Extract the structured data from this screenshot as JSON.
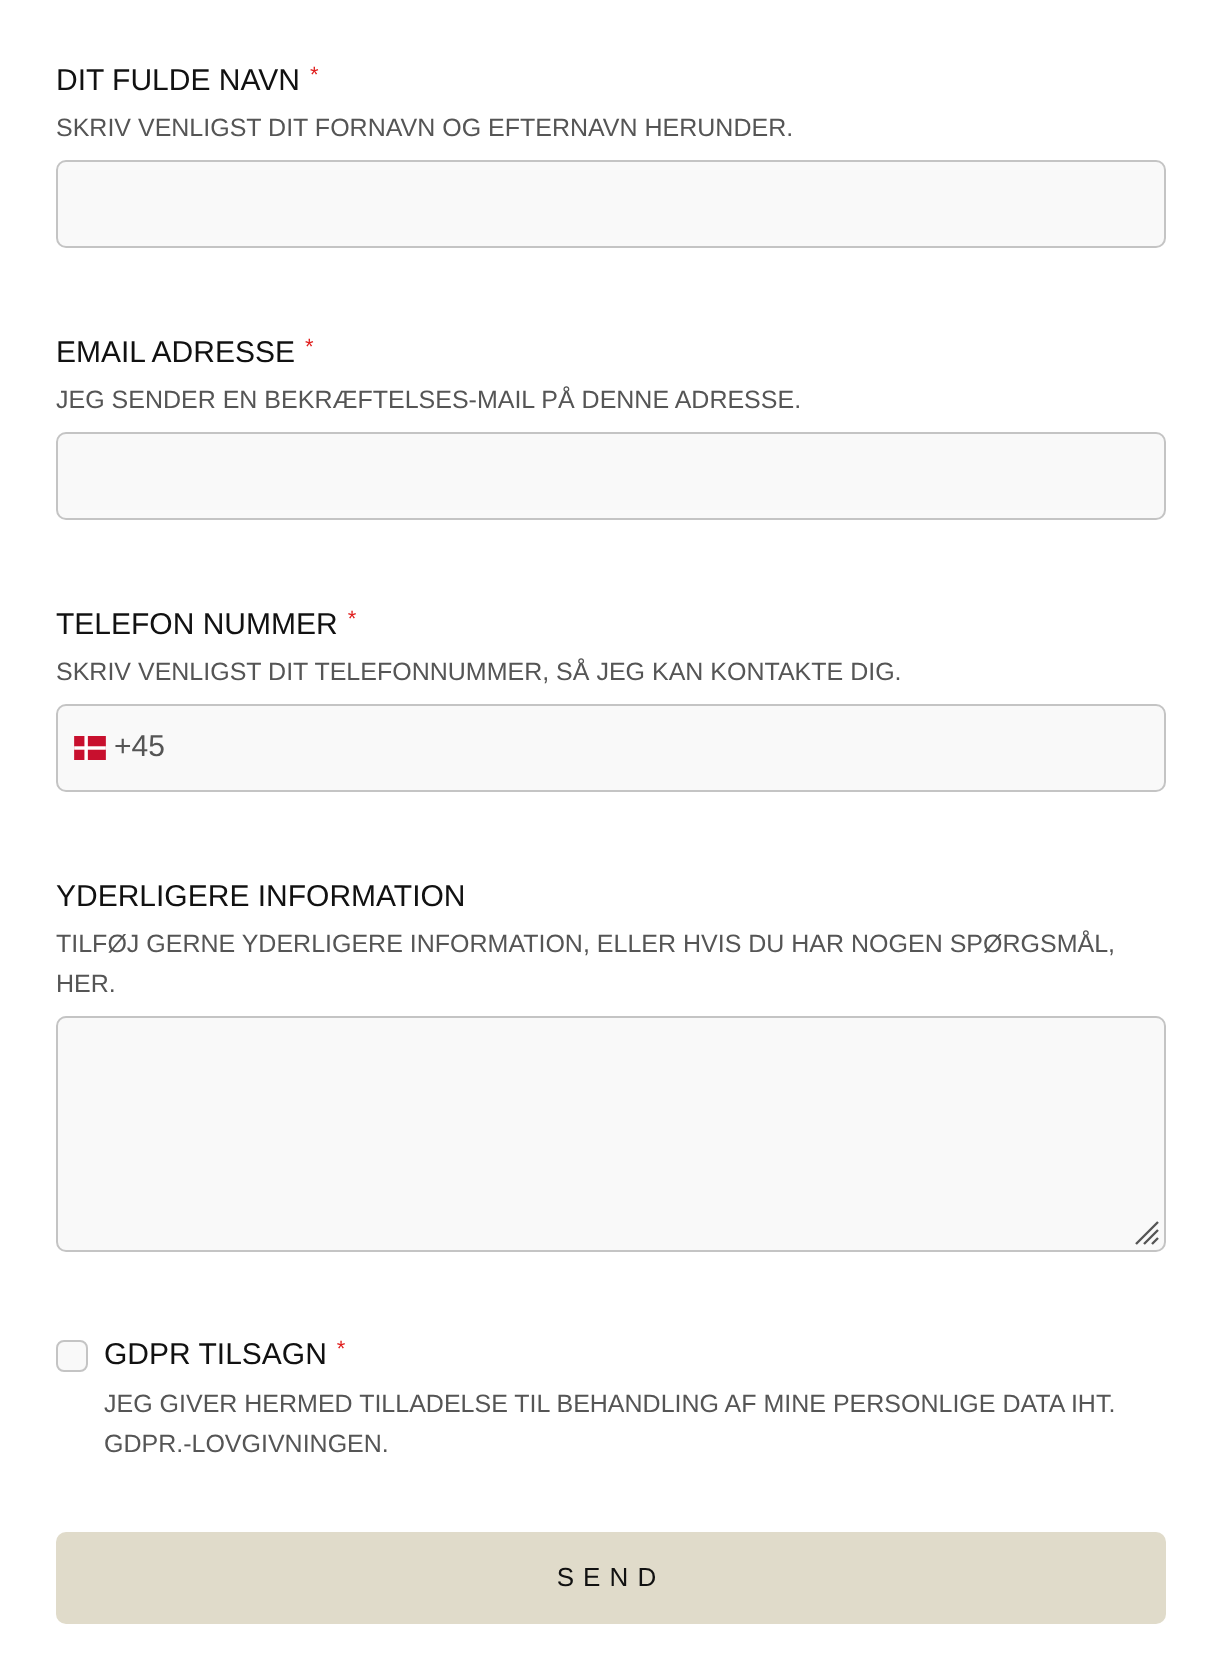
{
  "fields": [
    {
      "kind": "text",
      "label": "DIT FULDE NAVN",
      "required_mark": "*",
      "help": "SKRIV VENLIGST DIT FORNAVN OG EFTERNAVN HERUNDER."
    },
    {
      "kind": "email",
      "label": "EMAIL ADRESSE",
      "required_mark": "*",
      "help": "JEG SENDER EN BEKRÆFTELSES-MAIL PÅ DENNE ADRESSE."
    },
    {
      "kind": "phone",
      "label": "TELEFON NUMMER",
      "required_mark": "*",
      "help": "SKRIV VENLIGST DIT TELEFONNUMMER, SÅ JEG KAN KONTAKTE DIG.",
      "value": "+45"
    },
    {
      "kind": "textarea",
      "label": "YDERLIGERE INFORMATION",
      "help": "TILFØJ GERNE YDERLIGERE INFORMATION, ELLER HVIS DU HAR NOGEN SPØRGSMÅL, HER."
    }
  ],
  "consent": {
    "label": "GDPR TILSAGN",
    "required_mark": "*",
    "checked": false,
    "help": "JEG GIVER HERMED TILLADELSE TIL BEHANDLING AF MINE PERSONLIGE DATA IHT. GDPR.-LOVGIVNINGEN."
  },
  "submit": {
    "label": "SEND"
  }
}
